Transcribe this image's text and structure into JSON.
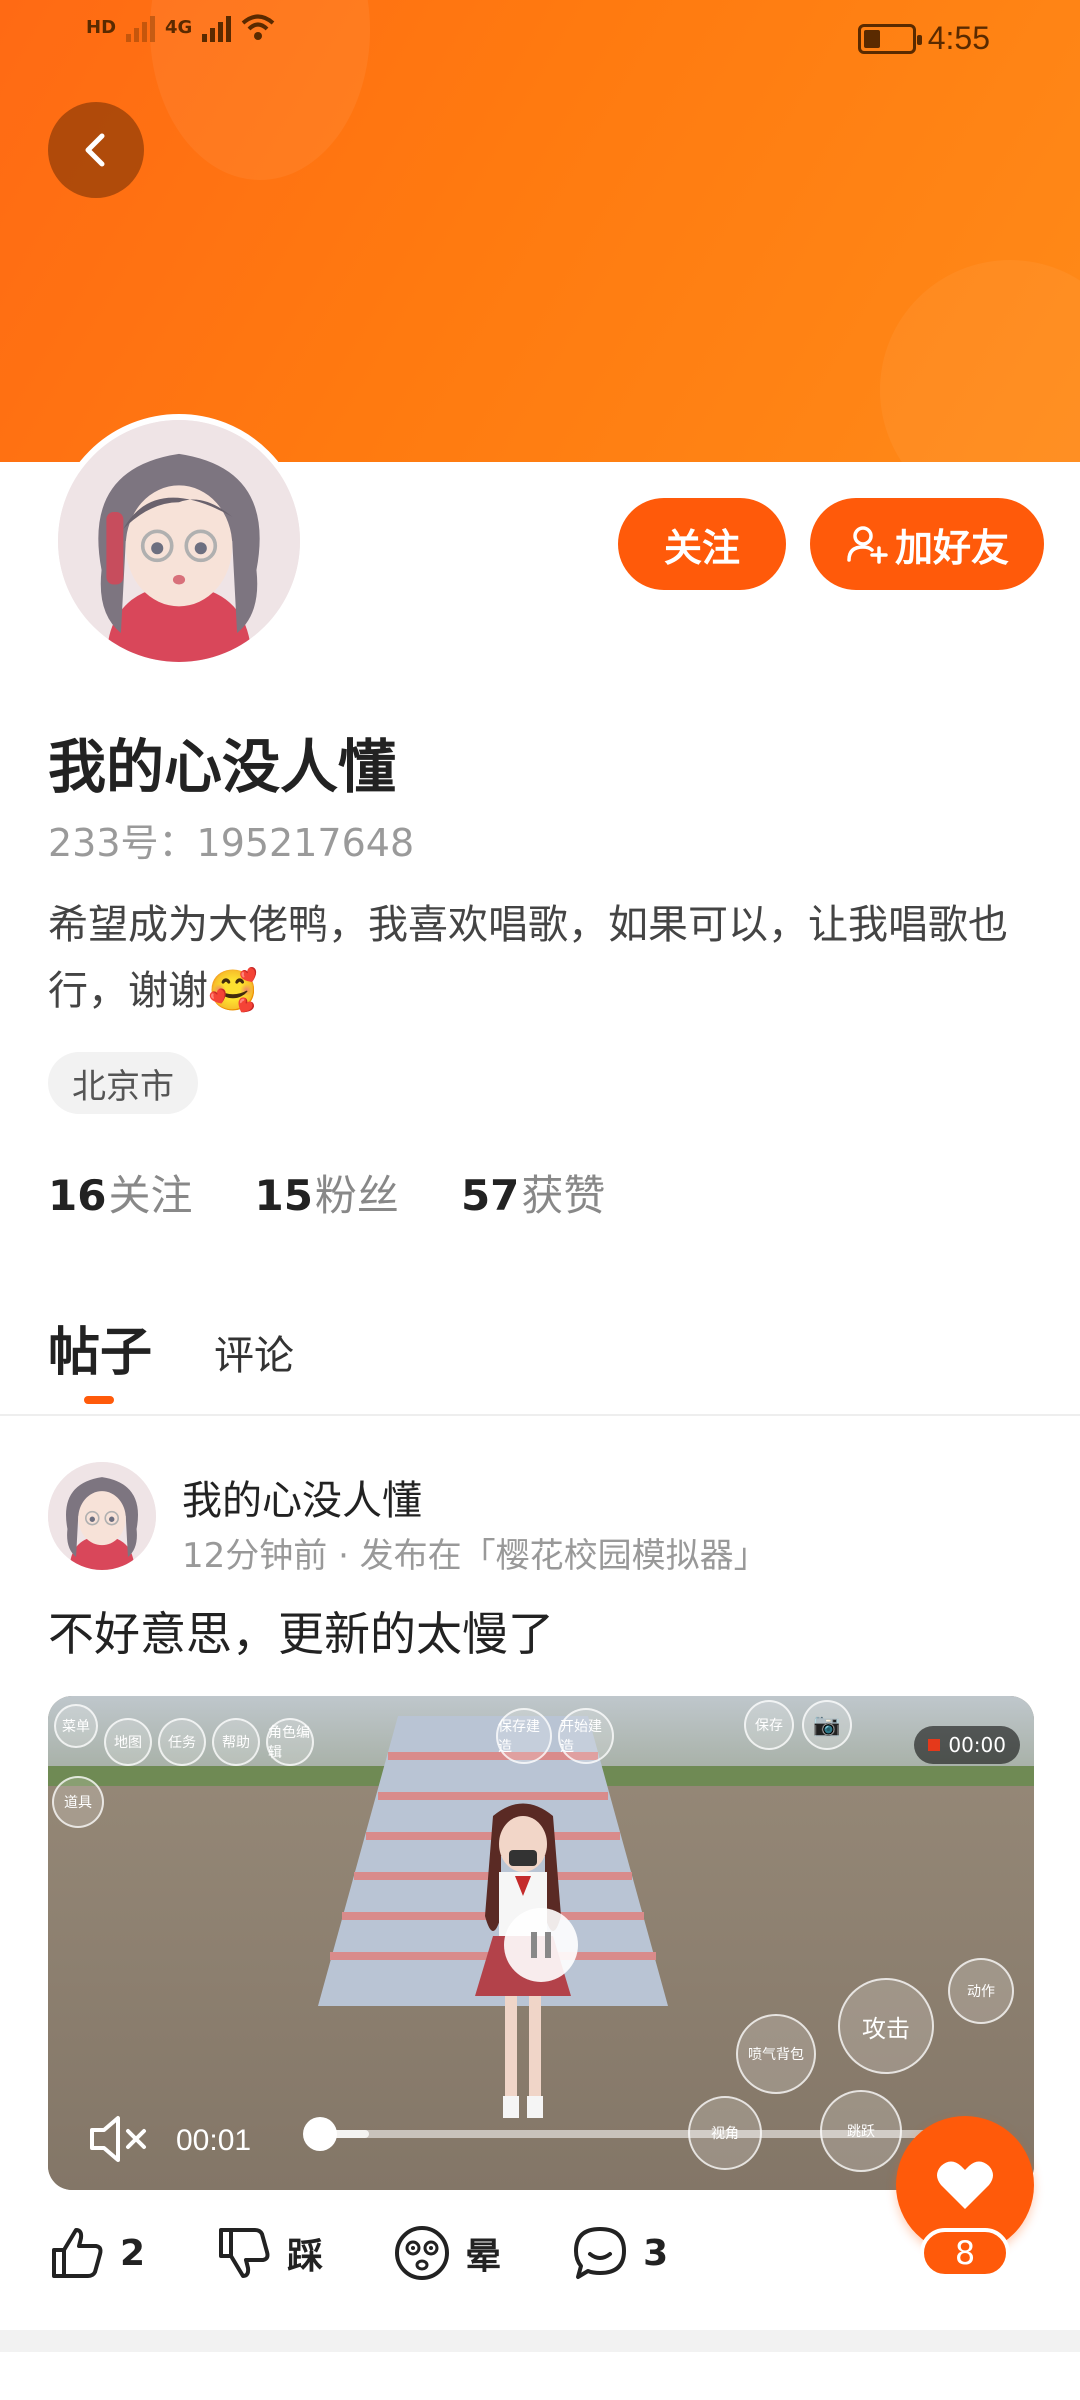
{
  "status_bar": {
    "left_indicator": "HD",
    "network_label": "4G",
    "time": "4:55"
  },
  "profile": {
    "name": "我的心没人懂",
    "id_text": "233号：195217648",
    "bio": "希望成为大佬鸭，我喜欢唱歌，如果可以，让我唱歌也行，谢谢🥰",
    "location": "北京市",
    "follow_button": "关注",
    "add_friend_button": "加好友",
    "stats": [
      {
        "count": "16",
        "label": "关注"
      },
      {
        "count": "15",
        "label": "粉丝"
      },
      {
        "count": "57",
        "label": "获赞"
      }
    ]
  },
  "tabs": [
    {
      "label": "帖子",
      "active": true
    },
    {
      "label": "评论",
      "active": false
    }
  ],
  "post": {
    "author": "我的心没人懂",
    "meta": "12分钟前 · 发布在「樱花校园模拟器」",
    "text": "不好意思，更新的太慢了",
    "video": {
      "current_time": "00:01",
      "record_time": "00:00",
      "progress": 0.0,
      "buffered": 0.08,
      "game_buttons": [
        "菜单",
        "地图",
        "任务",
        "帮助",
        "角色编辑",
        "保存建造",
        "开始建造",
        "保存",
        "道具",
        "攻击",
        "动作",
        "跳跃",
        "视角",
        "喷气背包"
      ]
    },
    "actions": [
      {
        "icon": "thumbs-up-icon",
        "label": "2"
      },
      {
        "icon": "thumbs-down-icon",
        "label": "踩"
      },
      {
        "icon": "dizzy-face-icon",
        "label": "晕"
      },
      {
        "icon": "comment-icon",
        "label": "3"
      }
    ],
    "like_count": "8"
  },
  "colors": {
    "accent": "#ff5a0a",
    "banner": "#ff7a10"
  }
}
